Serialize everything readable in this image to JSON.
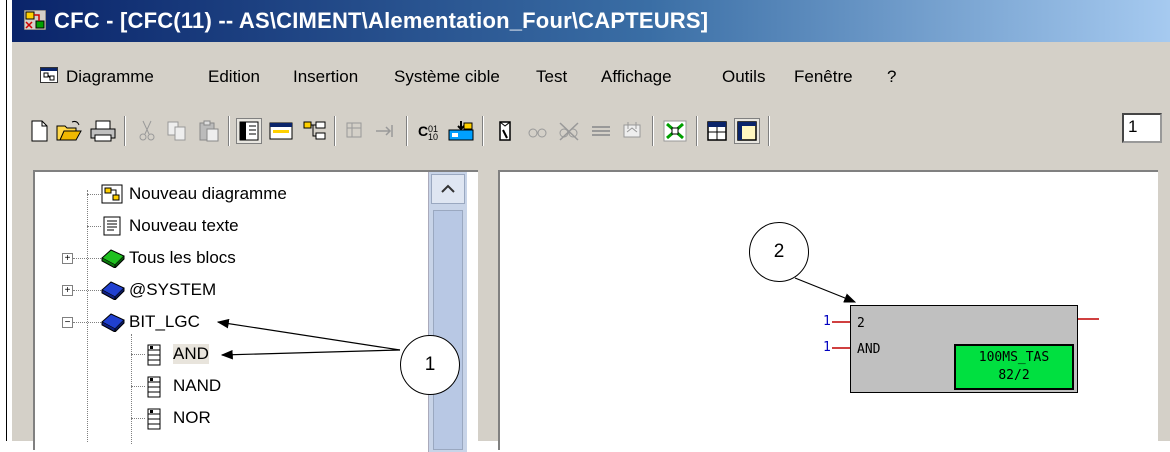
{
  "window": {
    "title": "CFC - [CFC(11) -- AS\\CIMENT\\Alementation_Four\\CAPTEURS]",
    "zoom_value": "1"
  },
  "menu": {
    "items": [
      "Diagramme",
      "Edition",
      "Insertion",
      "Système cible",
      "Test",
      "Affichage",
      "Outils",
      "Fenêtre",
      "?"
    ]
  },
  "toolbar": {
    "icons": [
      "new-icon",
      "open-icon",
      "print-icon",
      "cut-icon",
      "copy-icon",
      "paste-icon",
      "catalog-icon",
      "sheet-view-icon",
      "overview-icon",
      "grid-icon",
      "goto-icon",
      "compile-icon",
      "download-icon",
      "test-icon",
      "watch-icon",
      "remove-watch-icon",
      "trend-icon",
      "edit-icon",
      "fit-icon",
      "table-icon",
      "window-icon"
    ]
  },
  "tree": {
    "items": [
      {
        "label": "Nouveau diagramme",
        "icon": "diagram-icon",
        "expander": null
      },
      {
        "label": "Nouveau texte",
        "icon": "text-icon",
        "expander": null
      },
      {
        "label": "Tous les blocs",
        "icon": "book-green-icon",
        "expander": "+"
      },
      {
        "label": "@SYSTEM",
        "icon": "book-blue-icon",
        "expander": "+"
      },
      {
        "label": "BIT_LGC",
        "icon": "book-blue-icon",
        "expander": "−"
      },
      {
        "label": "AND",
        "icon": "block-icon",
        "expander": null
      },
      {
        "label": "NAND",
        "icon": "block-icon",
        "expander": null
      },
      {
        "label": "NOR",
        "icon": "block-icon",
        "expander": null
      }
    ]
  },
  "block": {
    "number": "2",
    "type": "AND",
    "runtime_group": "100MS_TAS",
    "sequence": "82/2",
    "input1": "1",
    "input2": "1"
  },
  "callouts": {
    "one": "1",
    "two": "2"
  },
  "colors": {
    "title_bar_start": "#0a246a",
    "title_bar_end": "#a6caf0",
    "block_body": "#c0c0c0",
    "runtime_badge": "#00e040",
    "pin_value": "#0000c0",
    "output_pin": "#c00000"
  }
}
